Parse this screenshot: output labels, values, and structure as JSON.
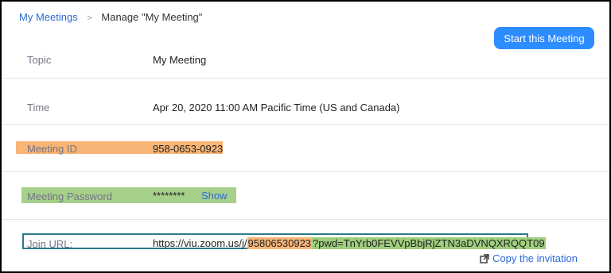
{
  "breadcrumb": {
    "parent": "My Meetings",
    "separator": ">",
    "current": "Manage \"My Meeting\""
  },
  "actions": {
    "start_label": "Start this Meeting"
  },
  "fields": {
    "topic": {
      "label": "Topic",
      "value": "My Meeting"
    },
    "time": {
      "label": "Time",
      "value": "Apr 20, 2020 11:00 AM Pacific Time (US and Canada)"
    },
    "meeting_id": {
      "label": "Meeting ID",
      "value": "958-0653-0923"
    },
    "password": {
      "label": "Meeting Password",
      "value": "********",
      "show_label": "Show"
    },
    "join_url": {
      "label": "Join URL:",
      "prefix": "https://viu.zoom.us/j/",
      "id": "95806530923",
      "pwd": "?pwd=TnYrb0FEVVpBbjRjZTN3aDVNQXRQQT09",
      "copy_label": "Copy the invitation"
    }
  },
  "colors": {
    "accent": "#2d8cff",
    "link": "#2d6ad7",
    "highlight_orange": "#f8b576",
    "highlight_green": "#9fce7d",
    "url_box_border": "#2b7b8c"
  },
  "icons": {
    "copy": "copy-invitation-icon"
  }
}
